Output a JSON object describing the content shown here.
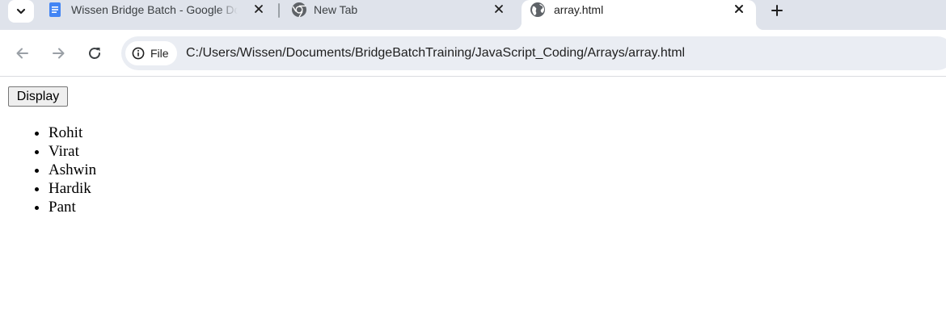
{
  "tabs": [
    {
      "title": "Wissen Bridge Batch - Google Docs",
      "icon": "google-docs-icon",
      "active": false
    },
    {
      "title": "New Tab",
      "icon": "chrome-icon",
      "active": false
    },
    {
      "title": "array.html",
      "icon": "globe-icon",
      "active": true
    }
  ],
  "toolbar": {
    "back_icon": "arrow-left-icon",
    "forward_icon": "arrow-right-icon",
    "reload_icon": "reload-icon"
  },
  "omnibox": {
    "chip_label": "File",
    "url": "C:/Users/Wissen/Documents/BridgeBatchTraining/JavaScript_Coding/Arrays/array.html"
  },
  "page": {
    "button_label": "Display",
    "items": [
      "Rohit",
      "Virat",
      "Ashwin",
      "Hardik",
      "Pant"
    ]
  },
  "colors": {
    "tab_strip": "#dfe3eb",
    "omnibox": "#eaedf3",
    "docs_blue": "#4285f4"
  }
}
